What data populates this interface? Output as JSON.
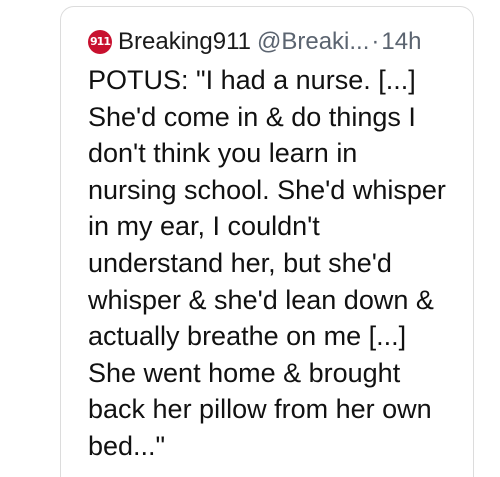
{
  "tweet": {
    "avatar_text": "911",
    "display_name": "Breaking911",
    "handle": "@Breaki...",
    "separator": "·",
    "timestamp": "14h",
    "lines": [
      "POTUS: \"I had a nurse. [...]",
      "She'd come in & do things I",
      "don't think you learn in",
      "nursing school. She'd whisper",
      "in my ear, I couldn't",
      "understand her, but she'd",
      "whisper & she'd lean down &",
      "actually breathe on me [...]",
      "She went home & brought",
      "back her pillow from her own",
      "bed...\""
    ]
  },
  "colors": {
    "avatar_bg": "#c8102e",
    "text": "#111111",
    "secondary_text": "#5b6470",
    "border": "#dcdcdc"
  }
}
